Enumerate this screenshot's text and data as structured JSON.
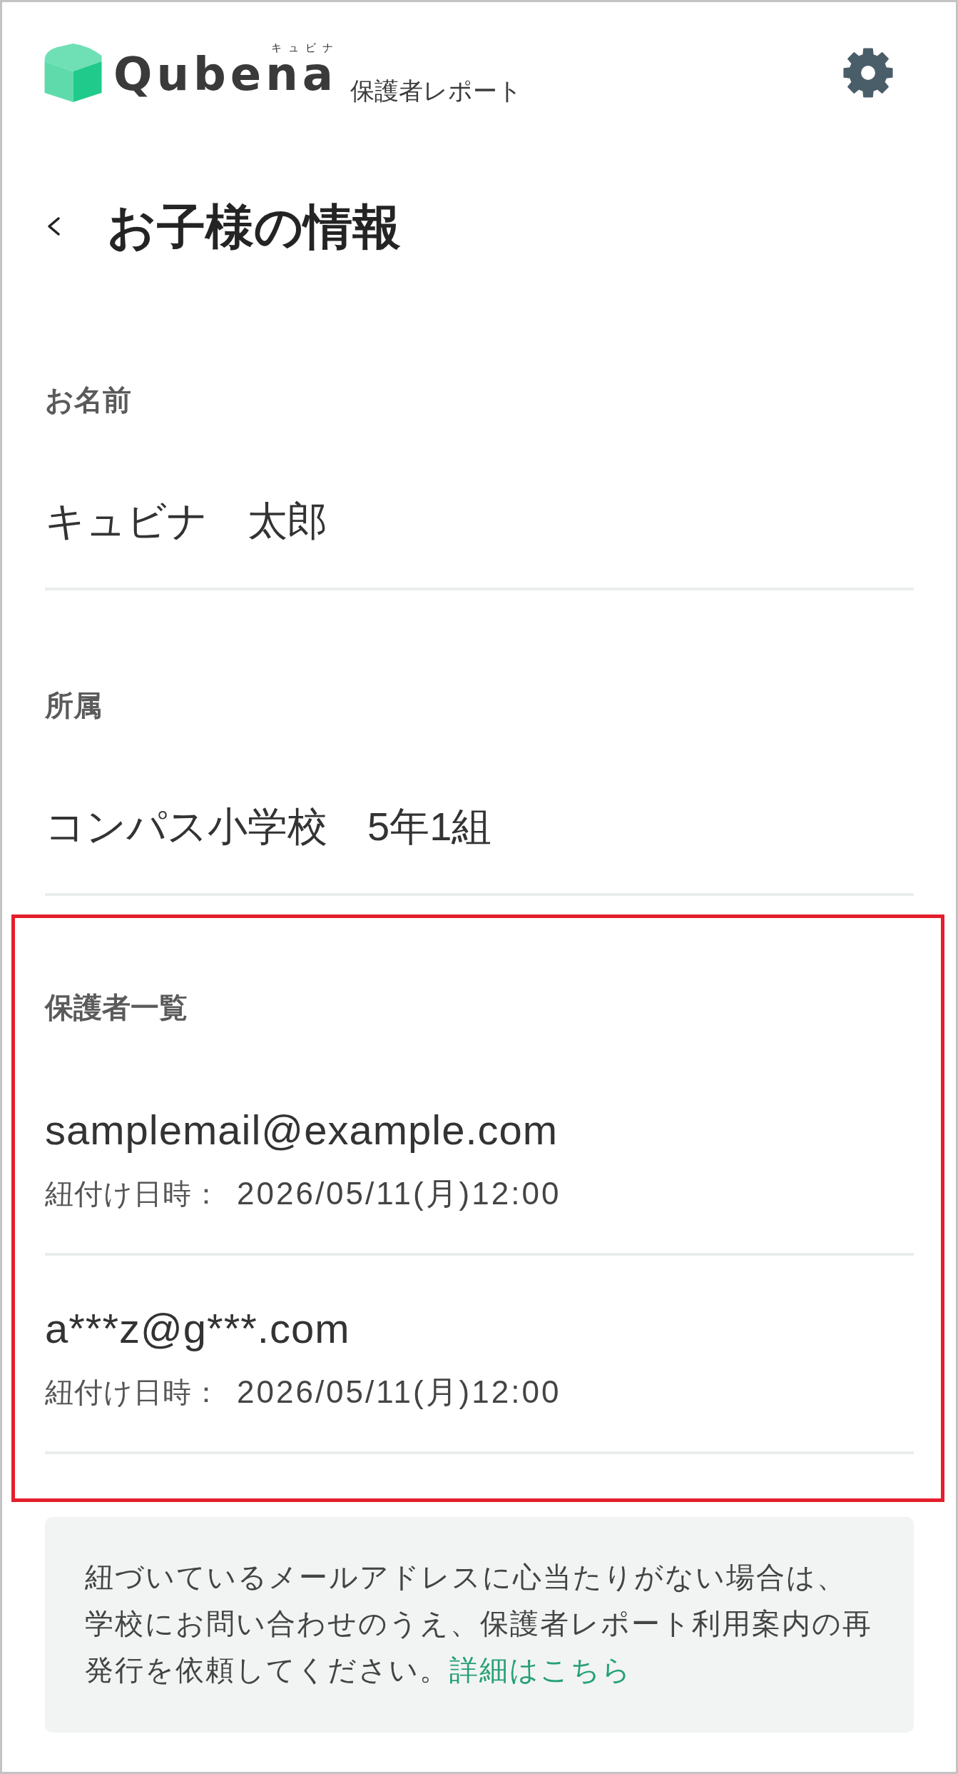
{
  "header": {
    "logo": {
      "ruby": "キュビナ",
      "wordmark": "Qubena"
    },
    "subtitle": "保護者レポート"
  },
  "page_title": "お子様の情報",
  "fields": [
    {
      "label": "お名前",
      "value": "キュビナ　太郎"
    },
    {
      "label": "所属",
      "value": "コンパス小学校　5年1組"
    }
  ],
  "guardians": {
    "label": "保護者一覧",
    "highlighted": true,
    "items": [
      {
        "email": "samplemail@example.com",
        "linked_label": "紐付け日時：",
        "linked_at": "2026/05/11(月)12:00"
      },
      {
        "email": "a***z@g***.com",
        "linked_label": "紐付け日時：",
        "linked_at": "2026/05/11(月)12:00"
      }
    ]
  },
  "notice": {
    "text": "紐づいているメールアドレスに心当たりがない場合は、学校にお問い合わせのうえ、保護者レポート利用案内の再発行を依頼してください。",
    "link": "詳細はこちら"
  }
}
